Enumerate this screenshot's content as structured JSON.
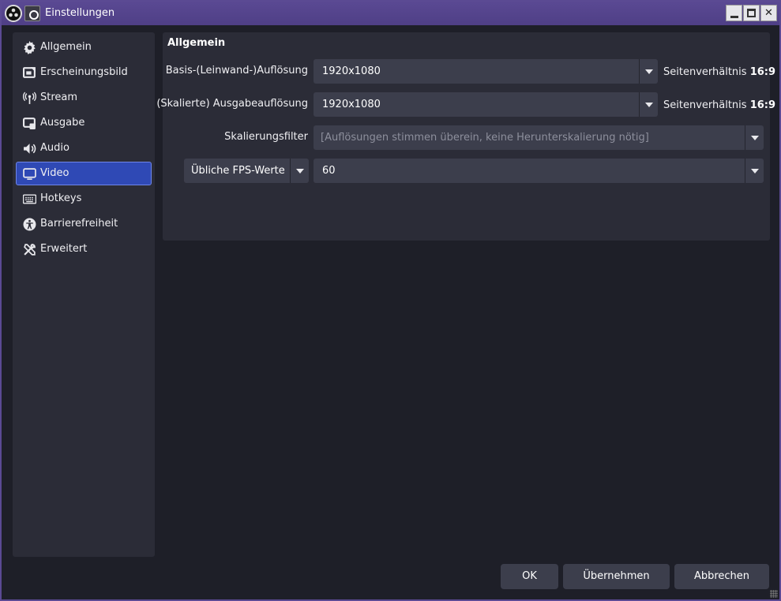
{
  "window": {
    "title": "Einstellungen"
  },
  "sidebar": {
    "items": [
      {
        "label": "Allgemein",
        "icon": "gear-icon",
        "active": false
      },
      {
        "label": "Erscheinungsbild",
        "icon": "appearance-icon",
        "active": false
      },
      {
        "label": "Stream",
        "icon": "broadcast-icon",
        "active": false
      },
      {
        "label": "Ausgabe",
        "icon": "output-icon",
        "active": false
      },
      {
        "label": "Audio",
        "icon": "speaker-icon",
        "active": false
      },
      {
        "label": "Video",
        "icon": "monitor-icon",
        "active": true
      },
      {
        "label": "Hotkeys",
        "icon": "keyboard-icon",
        "active": false
      },
      {
        "label": "Barrierefreiheit",
        "icon": "accessibility-icon",
        "active": false
      },
      {
        "label": "Erweitert",
        "icon": "tools-icon",
        "active": false
      }
    ]
  },
  "video": {
    "section_title": "Allgemein",
    "base_resolution": {
      "label": "Basis-(Leinwand-)Auflösung",
      "value": "1920x1080",
      "aspect_label": "Seitenverhältnis",
      "aspect_value": "16:9"
    },
    "output_resolution": {
      "label": "(Skalierte) Ausgabeauflösung",
      "value": "1920x1080",
      "aspect_label": "Seitenverhältnis",
      "aspect_value": "16:9"
    },
    "scale_filter": {
      "label": "Skalierungsfilter",
      "value": "[Auflösungen stimmen überein, keine Herunterskalierung nötig]"
    },
    "fps": {
      "type_value": "Übliche FPS-Werte",
      "value": "60"
    }
  },
  "buttons": {
    "ok": "OK",
    "apply": "Übernehmen",
    "cancel": "Abbrechen"
  },
  "colors": {
    "accent": "#2f49b5",
    "titlebar": "#5a4993",
    "background": "#1e1f28",
    "panel": "#2b2c37"
  }
}
